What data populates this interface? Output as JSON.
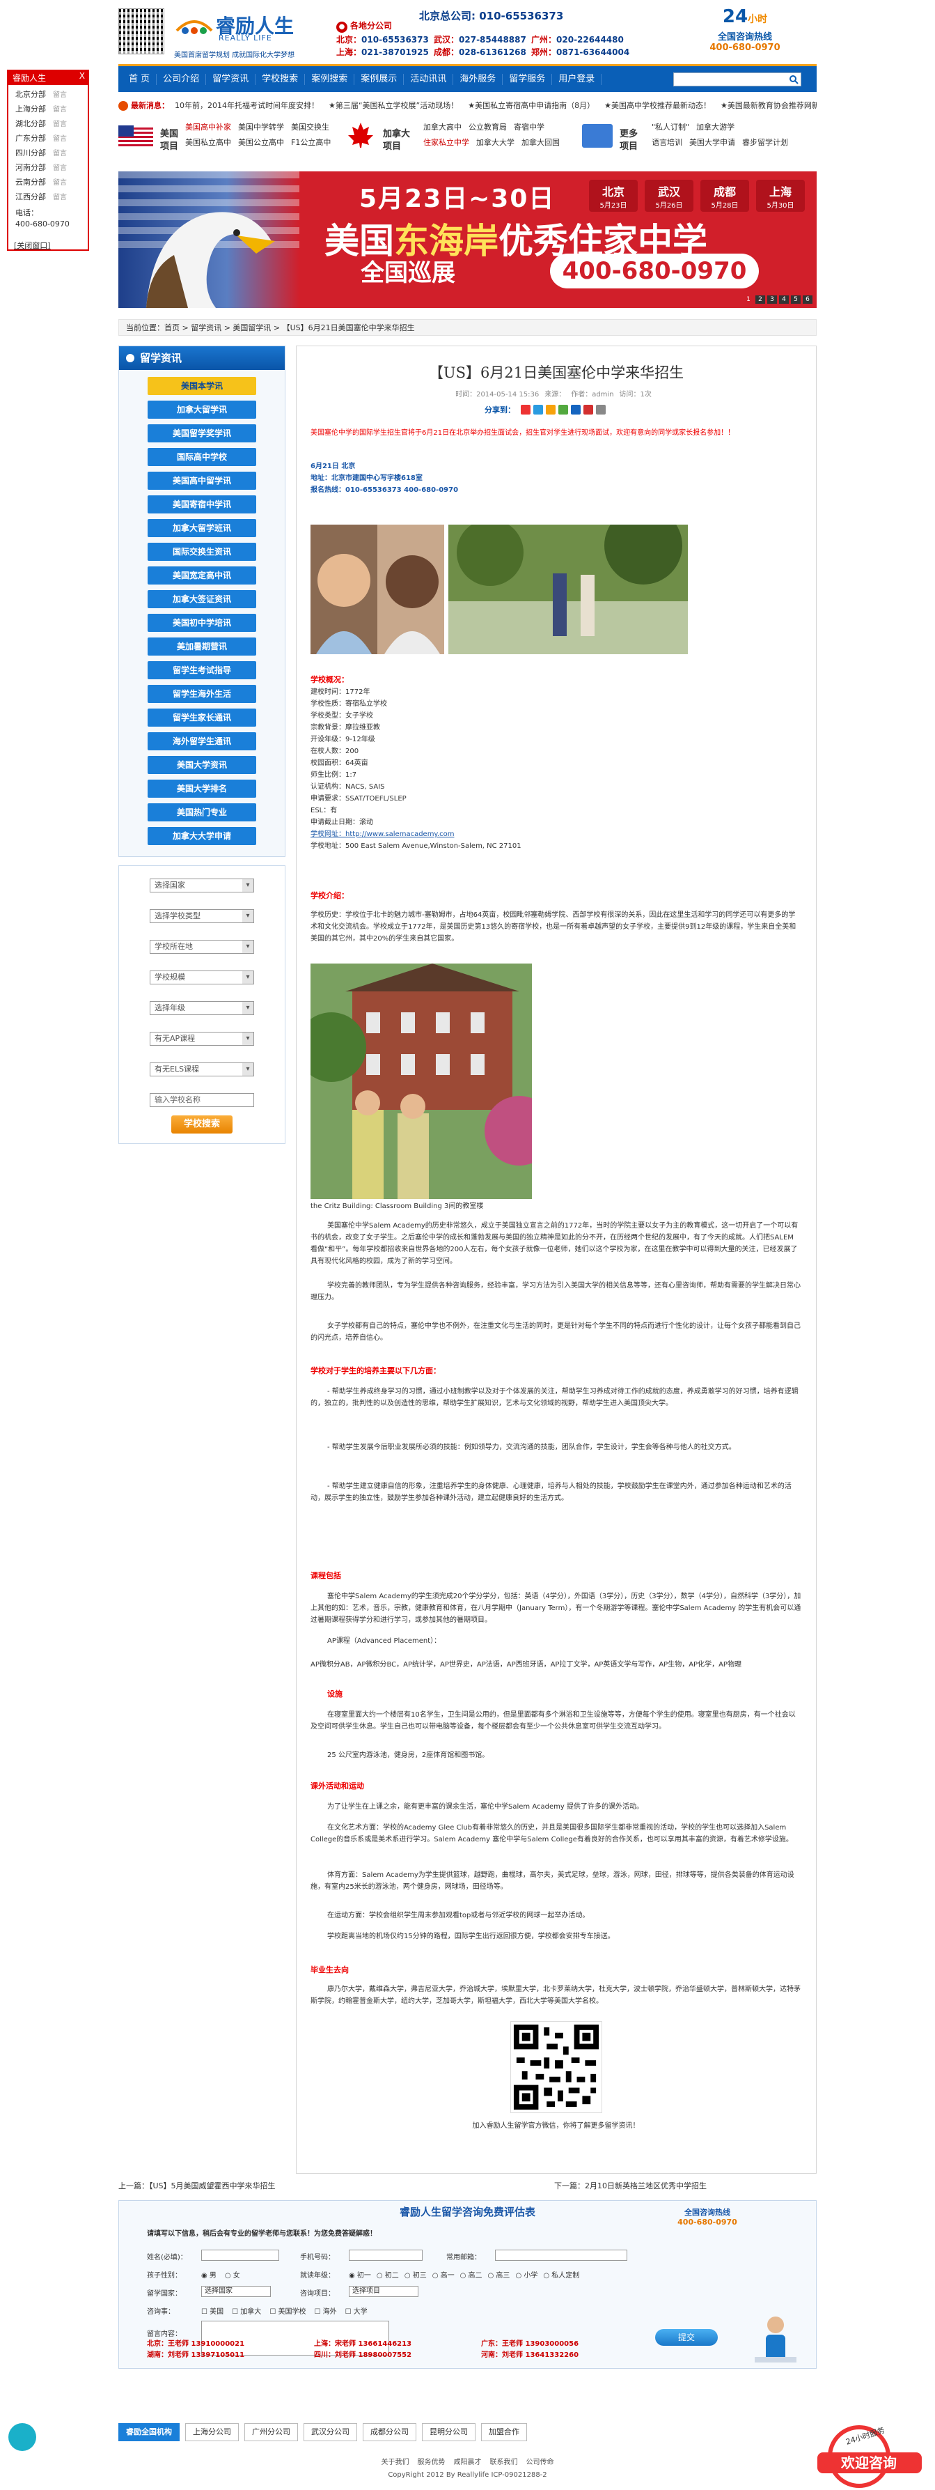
{
  "header": {
    "logo_cn": "睿励人生",
    "logo_en": "REALLY LIFE",
    "logo_tag": "美国首席留学规划 成就国际化大学梦想",
    "branch": "各地分公司",
    "hq": "北京总公司:  010-65536373",
    "phones": [
      {
        "city": "北京：",
        "num": "010-65536373"
      },
      {
        "city": "武汉：",
        "num": "027-85448887"
      },
      {
        "city": "广州：",
        "num": "020-22644480"
      },
      {
        "city": "上海：",
        "num": "021-38701925"
      },
      {
        "city": "成都：",
        "num": "028-61361268"
      },
      {
        "city": "郑州：",
        "num": "0871-63644004"
      }
    ],
    "hotline_big": "24",
    "hotline_sub": "小时",
    "hotline_title": "全国咨询热线",
    "hotline_num": "400-680-0970"
  },
  "nav": [
    "首 页",
    "公司介绍",
    "留学资讯",
    "学校搜索",
    "案例搜索",
    "案例展示",
    "活动讯讯",
    "海外服务",
    "留学服务",
    "用户登录"
  ],
  "ticker": {
    "label": "最新消息：",
    "items": [
      "10年前，2014年托福考试时间年度安排！",
      "★第三届“美国私立学校展”活动现场！",
      "★美国私立寄宿高中申请指南（8月）",
      "★美国高中学校推荐最新动态！",
      "★美国最新教育协会推荐网新闻",
      "★美国高中申请的各省时间安排",
      "★最新最快美国高中",
      "美国的私立学校"
    ]
  },
  "projects": {
    "us": {
      "title1": "美国",
      "title2": "项目",
      "row1": [
        "美国高中补家",
        "美国中学转学",
        "美国交换生"
      ],
      "row2": [
        "美国私立高中",
        "美国公立高中",
        "F1公立高中"
      ]
    },
    "ca": {
      "title1": "加拿大",
      "title2": "项目",
      "row1": [
        "加拿大高中",
        "公立教育局",
        "寄宿中学"
      ],
      "row2": [
        "住家私立中学",
        "加拿大大学",
        "加拿大回国"
      ]
    },
    "more": {
      "title1": "更多",
      "title2": "项目",
      "row1": [
        "\"私人订制\"",
        "加拿大游学"
      ],
      "row2": [
        "语言培训",
        "美国大学申请",
        "睿步留学计划"
      ]
    }
  },
  "banner": {
    "date": "5月23日~30日",
    "big1": "美国",
    "big2": "东海岸",
    "big3": "优秀住家中学",
    "sub": "全国巡展",
    "phone": "400-680-0970",
    "cities": [
      {
        "name": "北京",
        "date": "5月23日"
      },
      {
        "name": "武汉",
        "date": "5月26日"
      },
      {
        "name": "成都",
        "date": "5月28日"
      },
      {
        "name": "上海",
        "date": "5月30日"
      }
    ],
    "dots": [
      "1",
      "2",
      "3",
      "4",
      "5",
      "6"
    ]
  },
  "float": {
    "title": "睿励人生",
    "close": "X",
    "items": [
      {
        "n": "北京分部",
        "s": "留言"
      },
      {
        "n": "上海分部",
        "s": "留言"
      },
      {
        "n": "湖北分部",
        "s": "留言"
      },
      {
        "n": "广东分部",
        "s": "留言"
      },
      {
        "n": "四川分部",
        "s": "留言"
      },
      {
        "n": "河南分部",
        "s": "留言"
      },
      {
        "n": "云南分部",
        "s": "留言"
      },
      {
        "n": "江西分部",
        "s": "留言"
      }
    ],
    "tel_label": "电话：",
    "tel": "400-680-0970",
    "closebtn": "[关闭窗口]"
  },
  "crumb": "当前位置：首页 > 留学资讯 > 美国留学讯 > 【US】6月21日美国塞伦中学来华招生",
  "sidebar": {
    "title": "留学资讯",
    "items": [
      "美国本学讯",
      "加拿大留学讯",
      "美国留学奖学讯",
      "国际高中学校",
      "美国高中留学讯",
      "美国寄宿中学讯",
      "加拿大留学班讯",
      "国际交换生资讯",
      "美国宽定高中讯",
      "加拿大签证资讯",
      "美国初中学培讯",
      "美加暑期营讯",
      "留学生考试指导",
      "留学生海外生活",
      "留学生家长通讯",
      "海外留学生通讯",
      "美国大学资讯",
      "美国大学排名",
      "美国热门专业",
      "加拿大大学申请"
    ]
  },
  "filters": {
    "selects": [
      "选择国家",
      "选择学校类型",
      "学校所在地",
      "学校规模",
      "选择年级",
      "有无AP课程",
      "有无ELS课程"
    ],
    "input": "输入学校名称",
    "button": "学校搜索"
  },
  "article": {
    "title": "【US】6月21日美国塞伦中学来华招生",
    "meta": [
      "时间：2014-05-14 15:36",
      "来源：",
      "作者：admin",
      "访问：1次"
    ],
    "share_label": "分享到：",
    "intro": "美国塞伦中学的国际学生招生官将于6月21日在北京举办招生面试会，招生官对学生进行现场面试，欢迎有意向的同学或家长报名参加！！",
    "event": [
      "6月21日  北京",
      "地址：北京市建国中心写字楼618室",
      "报名热线：010-65536373  400-680-0970"
    ],
    "info_title": "学校概况：",
    "info": [
      "建校时间：1772年",
      "学校性质：寄宿私立学校",
      "学校类型：女子学校",
      "宗教背景：摩拉维亚教",
      "开设年级：9-12年级",
      "在校人数：200",
      "校园面积：64英亩",
      "师生比例：1:7",
      "认证机构：NACS, SAIS",
      "申请要求：SSAT/TOEFL/SLEP",
      "ESL：有",
      "申请截止日期：滚动",
      "学校网址：http://www.salemacademy.com",
      "学校地址：500 East Salem Avenue,Winston-Salem, NC 27101"
    ],
    "intro_title": "学校介绍：",
    "intro_p": "学校历史：学校位于北卡的魅力城市-塞勒姆市，占地64英亩，校园毗邻塞勒姆学院、西部学校有很深的关系，因此在这里生活和学习的同学还可以有更多的学术和文化交流机会。学校成立于1772年，是美国历史第13悠久的寄宿学校，也是一所有着卓越声望的女子学校，主要提供9到12年级的课程，学生来自全美和美国的其它州，其中20%的学生来自其它国家。",
    "photo_caption": "the Critz Building: Classroom Building 3间的教室楼",
    "p1": "美国塞伦中学Salem Academy的历史非常悠久，成立于美国独立宣言之前的1772年，当时的学院主要以女子为主的教育模式，这一切开启了一个可以有书的机会，改变了女子学生。之后塞伦中学的成长和蓬勃发展与美国的独立精神是如此的分不开，在历经两个世纪的发展中，有了今天的成就。人们把SALEM 看做“和平”。每年学校都招收来自世界各地的200人左右，每个女孩子就像一位老师，她们以这个学校为家，在这里在教学中可以得到大量的关注，已经发展了具有现代化风格的校园，成为了新的学习空间。",
    "p2": "学校完善的教师团队，专为学生提供各种咨询服务，经验丰富，学习方法为引入美国大学的相关信息等等，还有心里咨询师，帮助有需要的学生解决日常心理压力。",
    "p3": "女子学校都有自己的特点，塞伦中学也不例外，在注重文化与生活的同时，更是针对每个学生不同的特点而进行个性化的设计，让每个女孩子都能看到自己的闪光点，培养自信心。",
    "s_title": "学校对于学生的培养主要以下几方面：",
    "s1": "- 帮助学生养成终身学习的习惯，通过小班制教学以及对于个体发展的关注，帮助学生习养成对待工作的成就的态度，养成勇敢学习的好习惯，培养有逻辑的，独立的，批判性的以及创造性的思维，帮助学生扩展知识，艺术与文化领域的视野，帮助学生进入美国顶尖大学。",
    "s2": "- 帮助学生发展今后职业发展所必须的技能：例如领导力，交流沟通的技能，团队合作，学生设计，学生会等各种与他人的社交方式。",
    "s3": "- 帮助学生建立健康自信的形象，注重培养学生的身体健康、心理健康，培养与人相处的技能，学校鼓励学生在课堂内外，通过参加各种运动和艺术的活动，展示学生的独立性，鼓励学生参加各种课外活动，建立起健康良好的生活方式。",
    "c_title": "课程包括",
    "c1": "塞伦中学Salem Academy的学生须完成20个学分学分，包括：英语（4学分），外国语（3学分），历史（3学分），数学（4学分），自然科学（3学分），加上其他的如：艺术，音乐，宗教，健康教育和体育，在八月学期中（January Term），有一个冬期游学等课程。塞伦中学Salem Academy 的学生有机会可以通过暑期课程获得学分和进行学习，或参加其他的暑期项目。",
    "c2": "AP课程（Advanced Placement）：",
    "c3": "AP微积分AB，AP微积分BC，AP统计学，AP世界史，AP法语，AP西班牙语，AP拉丁文学，AP英语文学与写作，AP生物，AP化学，AP物理",
    "f_title": "设施",
    "f1": "在寝室里面大约一个楼层有10名学生，卫生间是公用的，但是里面都有多个淋浴和卫生设施等等，方便每个学生的使用。寝室里也有厨房，有一个社会以及空间可供学生休息。学生自己也可以带电脑等设备，每个楼层都会有至少一个公共休息室可供学生交流互动学习。",
    "f2": "25 公尺室内游泳池，健身房，2座体育馆和图书馆。",
    "a_title": "课外活动和运动",
    "a1": "为了让学生在上课之余，能有更丰富的课余生活，塞伦中学Salem Academy 提供了许多的课外活动。",
    "a2": "在文化艺术方面：学校的Academy Glee Club有着非常悠久的历史，并且是美国很多国际学生都非常重视的活动，学校的学生也可以选择加入Salem College的音乐系或是美术系进行学习。Salem Academy 塞伦中学与Salem College有着良好的合作关系，也可以享用其丰富的资源，有着艺术修学设施。",
    "a3": "体育方面：Salem Academy为学生提供篮球，越野跑，曲棍球，高尔夫，美式足球，垒球，游泳，网球，田径，排球等等，提供各类装备的体育运动设施，有室内25米长的游泳池，两个健身房，网球场，田径场等。",
    "a4": "在运动方面：学校会组织学生周末参加观看top或者与邻近学校的网球一起举办活动。",
    "a5": "学校距离当地的机场仅约15分钟的路程，国际学生出行返回很方便，学校都会安排专车接送。",
    "g_title": "毕业生去向",
    "g1": "康乃尔大学，戴维森大学，弗吉尼亚大学，乔治城大学，埃默里大学，北卡罗莱纳大学，杜克大学，波士顿学院，乔治华盛顿大学，普林斯顿大学，达特茅斯学院，约翰霍普金斯大学，纽约大学，芝加哥大学，斯坦福大学，西北大学等美国大学名校。",
    "qr_caption": "加入睿励人生留学官方微信，你将了解更多留学资讯！"
  },
  "prevnext": {
    "prev": "上一篇：【US】5月美国威望霍西中学来华招生",
    "next": "下一篇：2月10日新英格兰地区优秀中学招生"
  },
  "form": {
    "title": "睿励人生留学咨询免费评估表",
    "hotline_title": "全国咨询热线",
    "hotline": "400-680-0970",
    "note": "请填写以下信息，稍后会有专业的留学老师与您联系！为您免费答疑解惑！",
    "labels": [
      "姓名(必填)：",
      "手机号码：",
      "常用邮箱：",
      "孩子性别：",
      "就读年级：",
      "留学国家：",
      "咨询项目：",
      "咨询事：",
      "留言内容："
    ],
    "gender": [
      "男",
      "女"
    ],
    "grades": [
      "初一",
      "初二",
      "初三",
      "高一",
      "高二",
      "高三",
      "小学",
      "私人定制"
    ],
    "country_sel": "选择国家",
    "project_sel": "选择项目",
    "checks": [
      "美国",
      "加拿大",
      "美国学校",
      "海外",
      "大学"
    ],
    "submit": "提交",
    "contacts": [
      {
        "city": "北京：",
        "name": "王老师",
        "tel": "13910000021"
      },
      {
        "city": "上海：",
        "name": "宋老师",
        "tel": "13661446213"
      },
      {
        "city": "广东：",
        "name": "王老师",
        "tel": "13903000056"
      },
      {
        "city": "湖南：",
        "name": "刘老师",
        "tel": "13397105011"
      },
      {
        "city": "四川：",
        "name": "刘老师",
        "tel": "18980007552"
      },
      {
        "city": "河南：",
        "name": "刘老师",
        "tel": "13641332260"
      }
    ]
  },
  "footer": {
    "offices": [
      "睿励全国机构",
      "上海分公司",
      "广州分公司",
      "武汉分公司",
      "成都分公司",
      "昆明分公司",
      "加盟合作"
    ],
    "links": [
      "关于我们",
      "服务优势",
      "咸阳晨才",
      "联系我们",
      "公司传命"
    ],
    "copy": "CopyRight 2012 By Reallylife ICP-09021288-2",
    "consult_title": "欢迎咨询",
    "consult_24": "24小时服务"
  },
  "colors": {
    "nav": "#0a5fb7",
    "accent": "#f6a21a",
    "red": "#e00000"
  }
}
